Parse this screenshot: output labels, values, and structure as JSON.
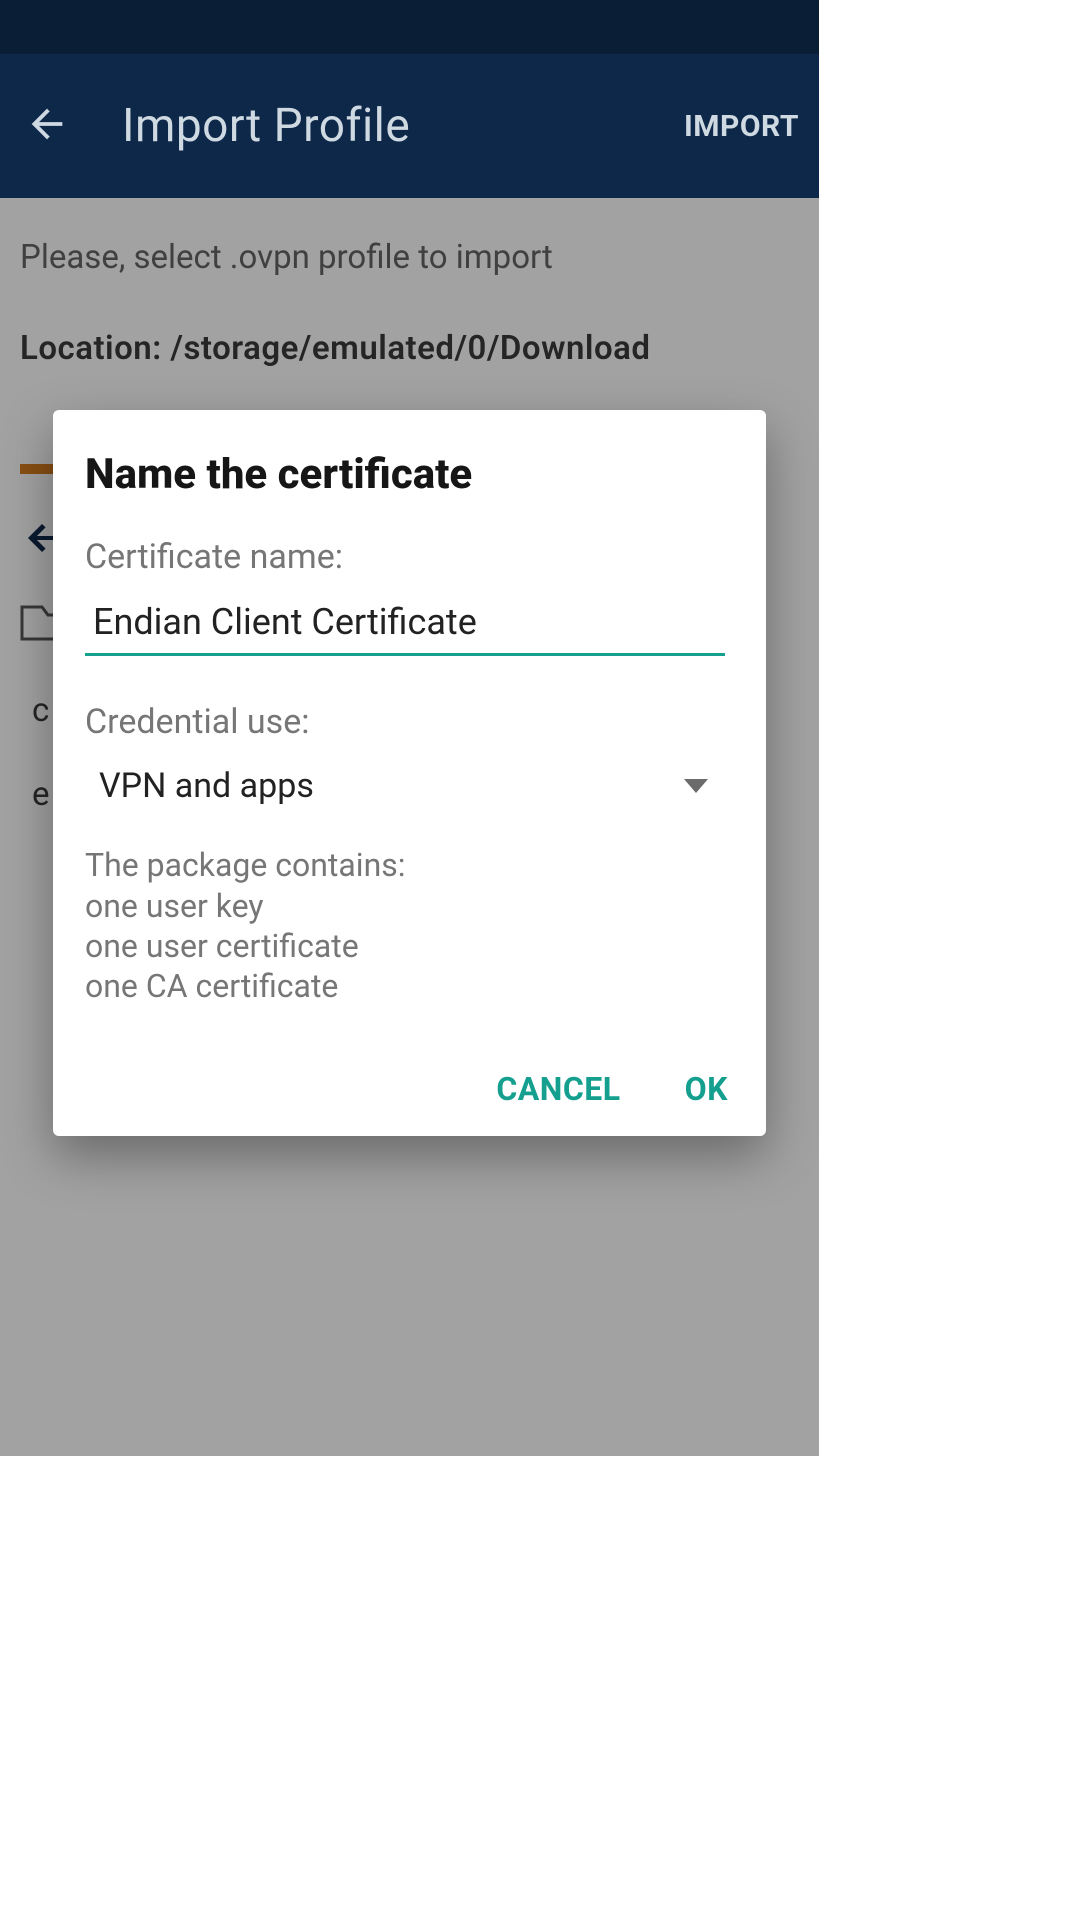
{
  "appbar": {
    "title": "Import Profile",
    "import_label": "IMPORT"
  },
  "body": {
    "instruction": "Please, select .ovpn profile to import",
    "location_label": "Location: ",
    "location_path": "/storage/emulated/0/Download",
    "rows": {
      "r1": "c",
      "r2": "e"
    }
  },
  "dialog": {
    "title": "Name the certificate",
    "cert_label": "Certificate name:",
    "cert_value": "Endian Client Certificate",
    "cred_label": "Credential use:",
    "cred_value": "VPN and apps",
    "pkg_label": "The package contains:",
    "pkg_items": {
      "a": "one user key",
      "b": "one user certificate",
      "c": "one CA certificate"
    },
    "cancel": "CANCEL",
    "ok": "OK"
  }
}
